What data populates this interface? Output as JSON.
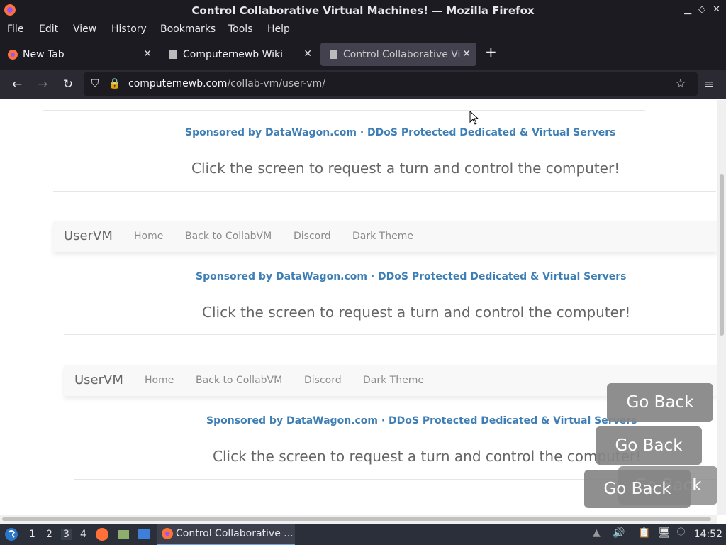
{
  "window": {
    "title": "Control Collaborative Virtual Machines! — Mozilla Firefox"
  },
  "menu": [
    "File",
    "Edit",
    "View",
    "History",
    "Bookmarks",
    "Tools",
    "Help"
  ],
  "tabs": [
    {
      "label": "New Tab"
    },
    {
      "label": "Computernewb Wiki"
    },
    {
      "label": "Control Collaborative Virt"
    }
  ],
  "url": {
    "host": "computernewb.com",
    "path": "/collab-vm/user-vm/"
  },
  "page": {
    "brand": "UserVM",
    "nav": [
      "Home",
      "Back to CollabVM",
      "Discord",
      "Dark Theme"
    ],
    "sponsor": "Sponsored by DataWagon.com · DDoS Protected Dedicated & Virtual Servers",
    "click_text": "Click the screen to request a turn and control the computer!",
    "go_back": "Go Back"
  },
  "taskbar": {
    "workspaces": [
      "1",
      "2",
      "3",
      "4"
    ],
    "active_task": "Control Collaborative ...",
    "clock": "14:52"
  }
}
